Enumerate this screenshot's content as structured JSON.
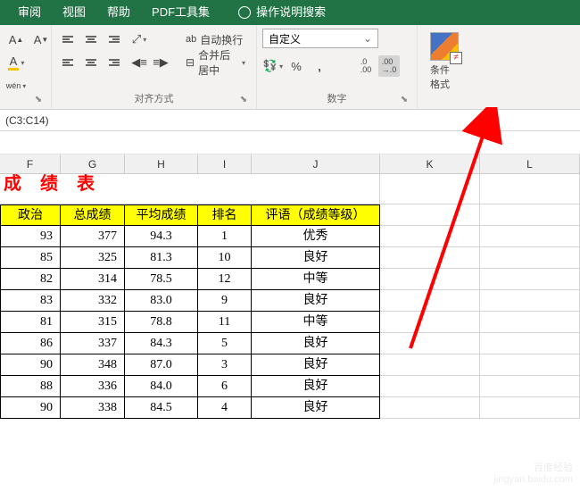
{
  "tabs": [
    "审阅",
    "视图",
    "帮助",
    "PDF工具集"
  ],
  "search_hint": "操作说明搜索",
  "ribbon": {
    "font_group_label": "",
    "align_group_label": "对齐方式",
    "number_group_label": "数字",
    "wrap_text": "自动换行",
    "merge_center": "合并后居中",
    "number_format": "自定义",
    "cond_format": "条件格式",
    "wen": "wén"
  },
  "formula": "(C3:C14)",
  "columns": [
    "F",
    "G",
    "H",
    "I",
    "J",
    "K",
    "L"
  ],
  "title": "成 绩 表",
  "headers": [
    "政治",
    "总成绩",
    "平均成绩",
    "排名",
    "评语（成绩等级）"
  ],
  "chart_data": {
    "type": "table",
    "columns": [
      "政治",
      "总成绩",
      "平均成绩",
      "排名",
      "评语（成绩等级）"
    ],
    "rows": [
      [
        93,
        377,
        94.3,
        1,
        "优秀"
      ],
      [
        85,
        325,
        81.3,
        10,
        "良好"
      ],
      [
        82,
        314,
        78.5,
        12,
        "中等"
      ],
      [
        83,
        332,
        83.0,
        9,
        "良好"
      ],
      [
        81,
        315,
        78.8,
        11,
        "中等"
      ],
      [
        86,
        337,
        84.3,
        5,
        "良好"
      ],
      [
        90,
        348,
        87.0,
        3,
        "良好"
      ],
      [
        88,
        336,
        84.0,
        6,
        "良好"
      ],
      [
        90,
        338,
        84.5,
        4,
        "良好"
      ]
    ]
  },
  "watermark": {
    "l1": "百度经验",
    "l2": "jingyan.baidu.com"
  }
}
